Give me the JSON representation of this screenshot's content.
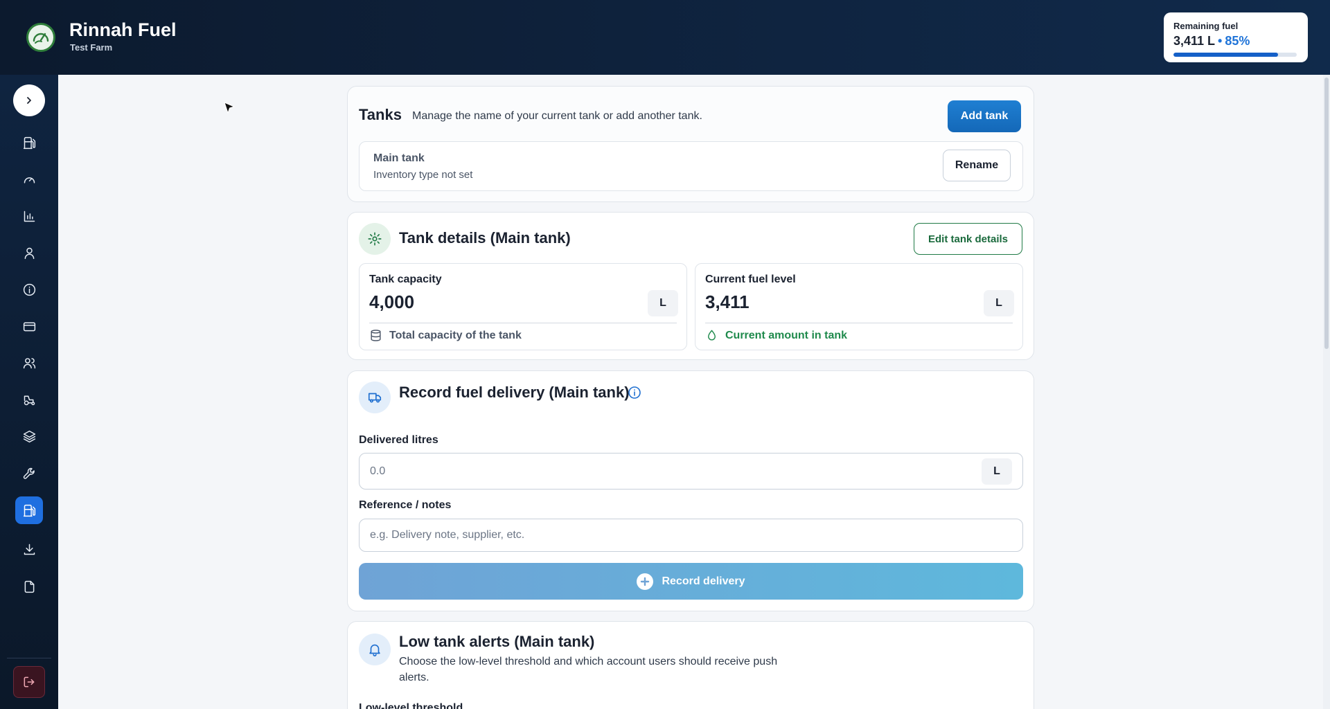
{
  "header": {
    "app_title": "Rinnah Fuel",
    "farm_name": "Test Farm",
    "remaining_fuel": {
      "label": "Remaining fuel",
      "litres": "3,411 L",
      "separator": "•",
      "percent": "85%",
      "percent_value": 0.85
    }
  },
  "sidebar": {
    "items": [
      {
        "name": "fuel-pump"
      },
      {
        "name": "gauge"
      },
      {
        "name": "bar-chart"
      },
      {
        "name": "user"
      },
      {
        "name": "info"
      },
      {
        "name": "credit-card"
      },
      {
        "name": "users"
      },
      {
        "name": "tractor"
      },
      {
        "name": "layers"
      },
      {
        "name": "wrench"
      },
      {
        "name": "fuel-tank",
        "active": true
      },
      {
        "name": "download"
      },
      {
        "name": "file"
      }
    ]
  },
  "tanks": {
    "title": "Tanks",
    "description": "Manage the name of your current tank or add another tank.",
    "add_button": "Add tank",
    "current": {
      "name": "Main tank",
      "inventory_type": "Inventory type not set",
      "rename_button": "Rename"
    }
  },
  "details": {
    "title": "Tank details (Main tank)",
    "edit_button": "Edit tank details",
    "capacity": {
      "label": "Tank capacity",
      "value": "4,000",
      "unit": "L",
      "footer": "Total capacity of the tank"
    },
    "level": {
      "label": "Current fuel level",
      "value": "3,411",
      "unit": "L",
      "footer": "Current amount in tank"
    }
  },
  "delivery": {
    "title": "Record fuel delivery (Main tank)",
    "litres_label": "Delivered litres",
    "litres_placeholder": "0.0",
    "litres_unit": "L",
    "notes_label": "Reference / notes",
    "notes_placeholder": "e.g. Delivery note, supplier, etc.",
    "submit_button": "Record delivery"
  },
  "alerts": {
    "title": "Low tank alerts (Main tank)",
    "description": "Choose the low-level threshold and which account users should receive push alerts.",
    "threshold_label": "Low-level threshold"
  },
  "colors": {
    "header_bg": "#0f2440",
    "accent_blue": "#1f6fe0",
    "accent_green": "#1f7a45"
  }
}
